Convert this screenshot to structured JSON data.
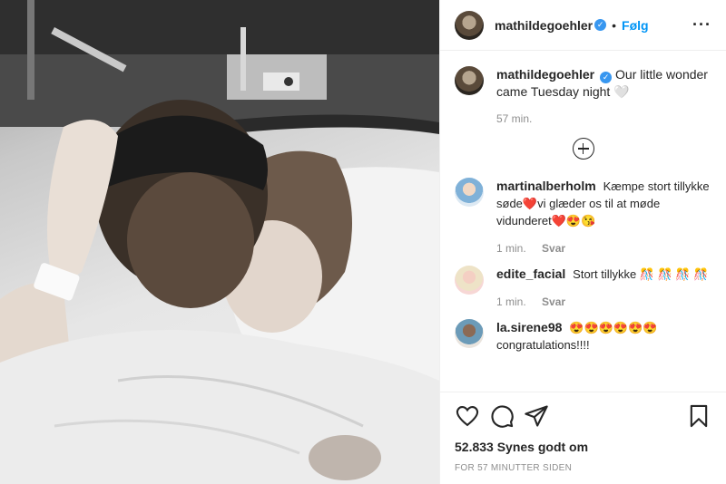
{
  "post": {
    "author": "mathildegoehler",
    "follow_label": "Følg",
    "more_icon": "more-horizontal-icon",
    "caption": {
      "username": "mathildegoehler",
      "text": "Our little wonder came Tuesday night 🤍",
      "time": "57 min."
    },
    "load_more_icon": "plus-circle-icon",
    "comments": [
      {
        "username": "martinalberholm",
        "text": "Kæmpe stort tillykke søde❤️vi glæder os til at møde vidunderet❤️😍😘",
        "time": "1 min.",
        "reply": "Svar"
      },
      {
        "username": "edite_facial",
        "text": "Stort tillykke 🎊 🎊 🎊 🎊",
        "time": "1 min.",
        "reply": "Svar"
      },
      {
        "username": "la.sirene98",
        "text": "😍😍😍😍😍😍 congratulations!!!!",
        "time": "",
        "reply": ""
      }
    ],
    "action_icons": [
      "heart-icon",
      "comment-icon",
      "share-icon",
      "bookmark-icon"
    ],
    "likes": "52.833 Synes godt om",
    "timestamp": "FOR 57 MINUTTER SIDEN"
  },
  "colors": {
    "link_blue": "#0095f6",
    "verified_blue": "#3897f0",
    "muted": "#8e8e8e",
    "text": "#262626"
  }
}
